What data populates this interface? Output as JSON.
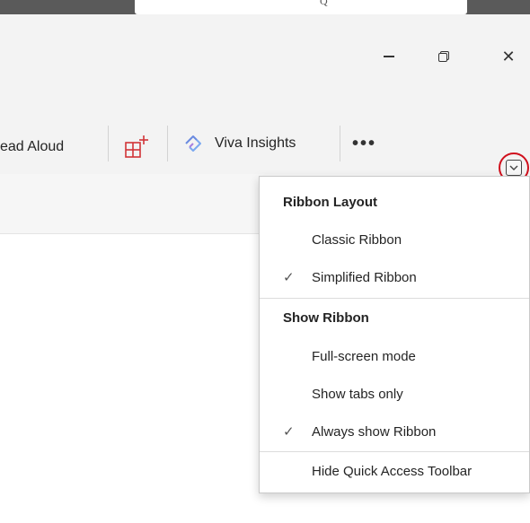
{
  "topbar": {
    "glyph": "Q"
  },
  "window_controls": {
    "minimize": "minimize",
    "restore": "restore",
    "close": "✕"
  },
  "ribbon": {
    "read_aloud_label": "ead Aloud",
    "viva_label": "Viva Insights",
    "more_label": "•••"
  },
  "menu": {
    "section1_title": "Ribbon Layout",
    "classic": {
      "label": "Classic Ribbon",
      "checked": false
    },
    "simplified": {
      "label": "Simplified Ribbon",
      "checked": true,
      "check": "✓"
    },
    "section2_title": "Show Ribbon",
    "fullscreen": {
      "label": "Full-screen mode",
      "checked": false
    },
    "tabs_only": {
      "label": "Show tabs only",
      "checked": false
    },
    "always": {
      "label": "Always show Ribbon",
      "checked": true,
      "check": "✓"
    },
    "hide_qat": {
      "label": "Hide Quick Access Toolbar"
    }
  },
  "colors": {
    "accent_red": "#d0101d",
    "apps_icon": "#d13438",
    "viva_icon": "#6a8ae0"
  }
}
